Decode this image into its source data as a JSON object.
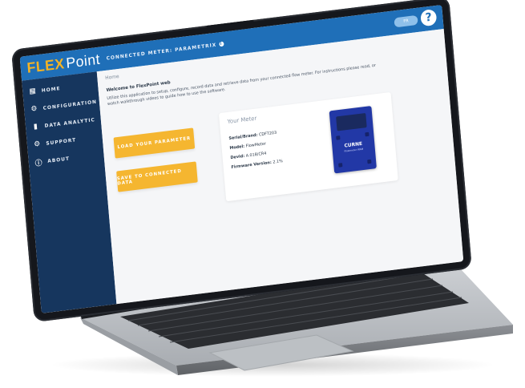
{
  "header": {
    "logo_flex": "FLEX",
    "logo_point": "Point",
    "connection_label": "CONNECTED METER: PARAMETRIX",
    "toggle_label": "FR",
    "help_glyph": "?"
  },
  "sidebar": {
    "items": [
      {
        "icon": "home-icon",
        "glyph": "▦",
        "label": "HOME"
      },
      {
        "icon": "gear-icon",
        "glyph": "⚙",
        "label": "CONFIGURATION"
      },
      {
        "icon": "chart-icon",
        "glyph": "▮",
        "label": "DATA ANALYTIC"
      },
      {
        "icon": "support-icon",
        "glyph": "⚙",
        "label": "SUPPORT"
      },
      {
        "icon": "info-icon",
        "glyph": "ⓘ",
        "label": "ABOUT"
      }
    ]
  },
  "main": {
    "breadcrumb": "Home",
    "welcome": "Welcome to FlexPoint web",
    "description": "Utilize this application to setup, configure, record data and retrieve data from your connected flow meter. For instructions please read, or watch walkthrough videos to guide how to use the software.",
    "buttons": {
      "load": "LOAD YOUR PARAMETER",
      "save": "SAVE TO CONNECTED DATA"
    },
    "meter": {
      "title": "Your Meter",
      "lines": [
        {
          "label": "Serial/Brand:",
          "value": "CDFT203"
        },
        {
          "label": "Model:",
          "value": "FlowMeter"
        },
        {
          "label": "Devid:",
          "value": "A.018/CR4"
        },
        {
          "label": "Firmware Version:",
          "value": "2.1%"
        }
      ],
      "device_brand": "CURNE",
      "device_sub": "Flowmeter WAM"
    }
  },
  "colors": {
    "header_blue": "#1f6fb8",
    "sidebar_navy": "#16365e",
    "accent_yellow": "#f5b630",
    "device_blue": "#2238a6"
  }
}
